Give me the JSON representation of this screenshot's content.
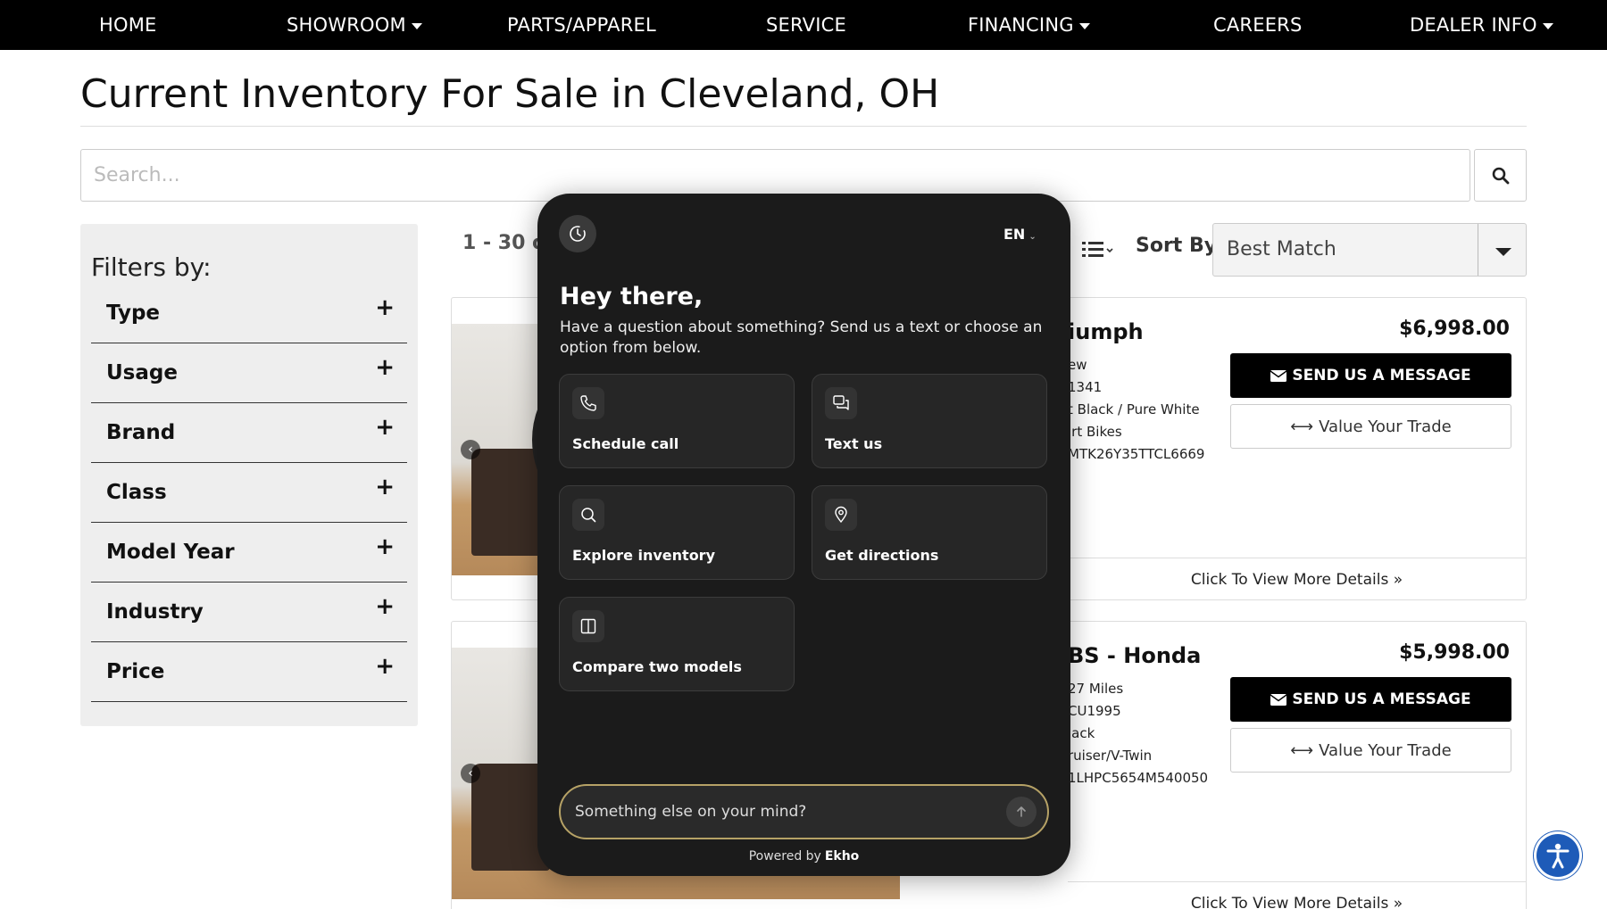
{
  "nav": {
    "items": [
      {
        "label": "HOME",
        "dropdown": false
      },
      {
        "label": "SHOWROOM",
        "dropdown": true
      },
      {
        "label": "PARTS/APPAREL",
        "dropdown": false
      },
      {
        "label": "SERVICE",
        "dropdown": false
      },
      {
        "label": "FINANCING",
        "dropdown": true
      },
      {
        "label": "CAREERS",
        "dropdown": false
      },
      {
        "label": "DEALER INFO",
        "dropdown": true
      }
    ]
  },
  "page": {
    "title": "Current Inventory For Sale in Cleveland, OH"
  },
  "search": {
    "placeholder": "Search..."
  },
  "filters": {
    "title": "Filters by:",
    "items": [
      "Type",
      "Usage",
      "Brand",
      "Class",
      "Model Year",
      "Industry",
      "Price"
    ],
    "expand_symbol": "+"
  },
  "results": {
    "count_text": "1 - 30 of",
    "sort_label": "Sort By:",
    "sort_value": "Best Match"
  },
  "listings": [
    {
      "title": "iumph",
      "price": "$6,998.00",
      "specs": [
        "ew",
        "1341",
        "t Black / Pure White",
        "irt Bikes",
        "MTK26Y35TTCL6669"
      ],
      "message_btn": "SEND US A MESSAGE",
      "trade_btn": "Value Your Trade",
      "details_link": "Click To View More Details »"
    },
    {
      "title": "BS - Honda",
      "price": "$5,998.00",
      "specs": [
        "27 Miles",
        "CU1995",
        "lack",
        "ruiser/V-Twin",
        "1LHPC5654M540050"
      ],
      "message_btn": "SEND US A MESSAGE",
      "trade_btn": "Value Your Trade",
      "details_link": "Click To View More Details »"
    }
  ],
  "chat": {
    "language": "EN",
    "greeting": "Hey there,",
    "subtitle": "Have a question about something? Send us a text or choose an option from below.",
    "options": [
      {
        "label": "Schedule call",
        "icon": "phone-icon"
      },
      {
        "label": "Text us",
        "icon": "chat-bubbles-icon"
      },
      {
        "label": "Explore inventory",
        "icon": "search-icon"
      },
      {
        "label": "Get directions",
        "icon": "map-pin-icon"
      },
      {
        "label": "Compare two models",
        "icon": "columns-icon"
      }
    ],
    "input_placeholder": "Something else on your mind?",
    "powered_by": "Powered by",
    "brand": "Ekho"
  },
  "colors": {
    "nav_bg": "#000000",
    "chat_bg": "#1b1b1b",
    "input_border": "#b6a266",
    "accessibility": "#1e5bb8"
  }
}
